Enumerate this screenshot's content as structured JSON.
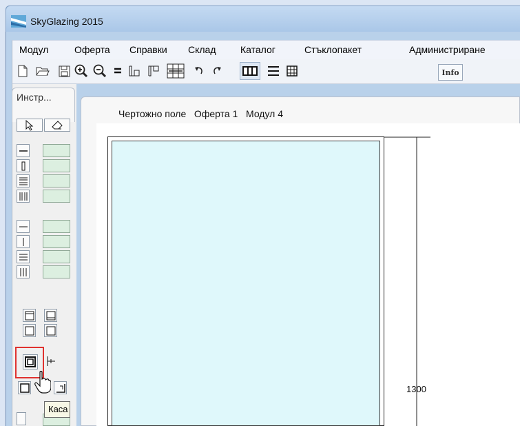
{
  "window": {
    "title": "SkyGlazing 2015"
  },
  "menu": {
    "items": [
      "Модул",
      "Оферта",
      "Справки",
      "Склад",
      "Каталог",
      "Стъклопакет",
      "Администриране"
    ]
  },
  "toolbar": {
    "buttons": [
      "new-document-icon",
      "open-folder-icon",
      "save-icon",
      "zoom-in-icon",
      "zoom-out-icon",
      "equal-icon",
      "bottom-profile-icon",
      "top-profile-icon",
      "grid-cut-icon",
      "undo-icon",
      "redo-icon",
      "split-view-icon",
      "lines-view-icon",
      "table-view-icon"
    ],
    "info_label": "Info"
  },
  "tools_panel": {
    "tab_label": "Инстр...",
    "tooltip": "Каса"
  },
  "drawing": {
    "header": "Чертожно поле   Оферта 1   Модул 4",
    "dimension_label": "1300",
    "glass_color": "#dff8fb"
  },
  "colors": {
    "accent": "#e0312f",
    "green_slot": "#dcefe0"
  }
}
